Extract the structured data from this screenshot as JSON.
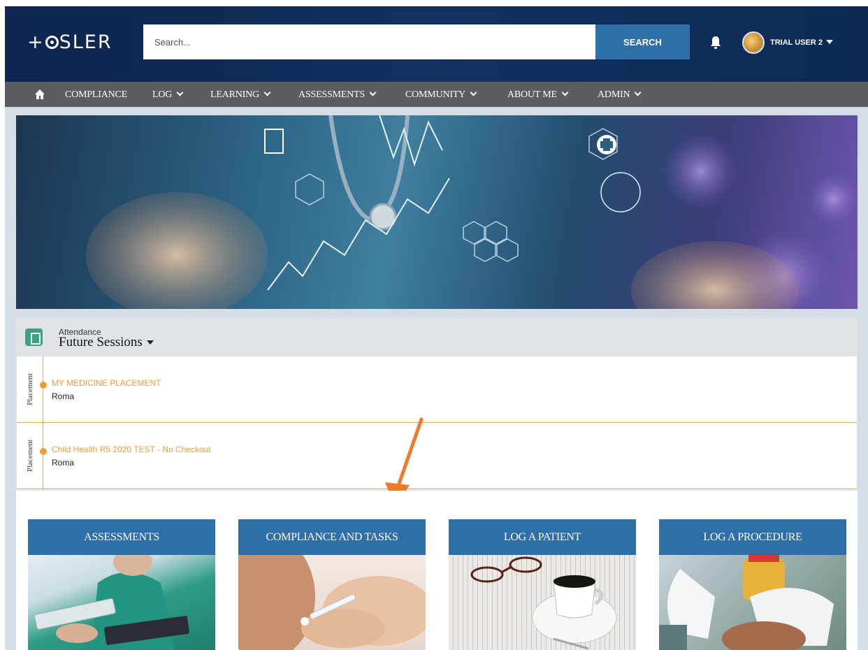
{
  "header": {
    "logo_text": "+OSLER",
    "search": {
      "placeholder": "Search...",
      "button_label": "SEARCH"
    },
    "user": {
      "name": "TRIAL USER 2"
    }
  },
  "nav": {
    "items": [
      {
        "label": "COMPLIANCE",
        "has_dropdown": false
      },
      {
        "label": "LOG",
        "has_dropdown": true
      },
      {
        "label": "LEARNING",
        "has_dropdown": true
      },
      {
        "label": "ASSESSMENTS",
        "has_dropdown": true
      },
      {
        "label": "COMMUNITY",
        "has_dropdown": true
      },
      {
        "label": "ABOUT ME",
        "has_dropdown": true
      },
      {
        "label": "ADMIN",
        "has_dropdown": true
      }
    ]
  },
  "attendance": {
    "subtitle": "Attendance",
    "title": "Future Sessions",
    "sessions": [
      {
        "type": "Placement",
        "title": "MY MEDICINE PLACEMENT",
        "location": "Roma"
      },
      {
        "type": "Placement",
        "title": "Child Health R5 2020 TEST - No Checkout",
        "location": "Roma"
      }
    ]
  },
  "tiles": [
    {
      "label": "ASSESSMENTS",
      "image": "doctor-with-tablet"
    },
    {
      "label": "COMPLIANCE AND TASKS",
      "image": "vaccination-injection"
    },
    {
      "label": "LOG A PATIENT",
      "image": "coffee-and-glasses-on-newspaper"
    },
    {
      "label": "LOG A PROCEDURE",
      "image": "gloved-hands-procedure"
    }
  ],
  "colors": {
    "header_bg": "#12305f",
    "nav_bg": "#5a5d61",
    "accent_blue": "#2f6fa8",
    "accent_orange": "#f09a38",
    "attendance_icon": "#3ba28a"
  }
}
